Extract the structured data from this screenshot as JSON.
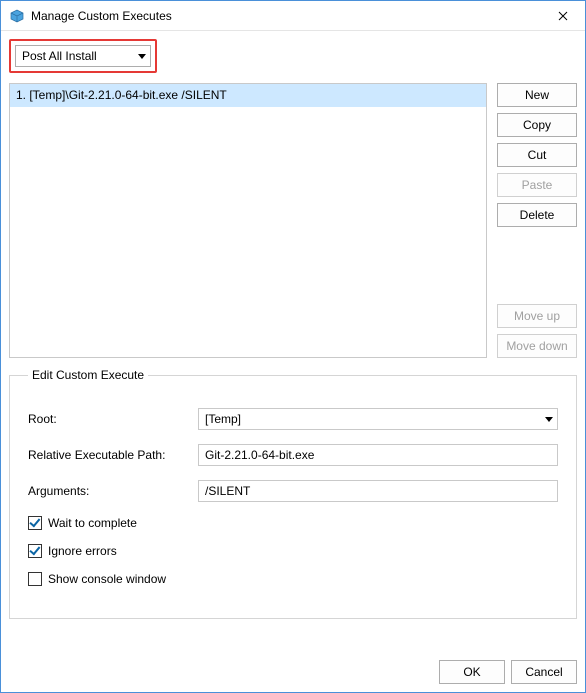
{
  "window": {
    "title": "Manage Custom Executes"
  },
  "typeSelector": {
    "selected": "Post All Install"
  },
  "list": {
    "items": [
      {
        "label": "1. [Temp]\\Git-2.21.0-64-bit.exe /SILENT"
      }
    ]
  },
  "sideButtons": {
    "new": "New",
    "copy": "Copy",
    "cut": "Cut",
    "paste": "Paste",
    "delete": "Delete",
    "moveUp": "Move up",
    "moveDown": "Move down"
  },
  "edit": {
    "legend": "Edit Custom Execute",
    "rootLabel": "Root:",
    "rootValue": "[Temp]",
    "pathLabel": "Relative Executable Path:",
    "pathValue": "Git-2.21.0-64-bit.exe",
    "argsLabel": "Arguments:",
    "argsValue": "/SILENT",
    "waitLabel": "Wait to complete",
    "waitChecked": true,
    "ignoreLabel": "Ignore errors",
    "ignoreChecked": true,
    "consoleLabel": "Show console window",
    "consoleChecked": false
  },
  "footer": {
    "ok": "OK",
    "cancel": "Cancel"
  }
}
